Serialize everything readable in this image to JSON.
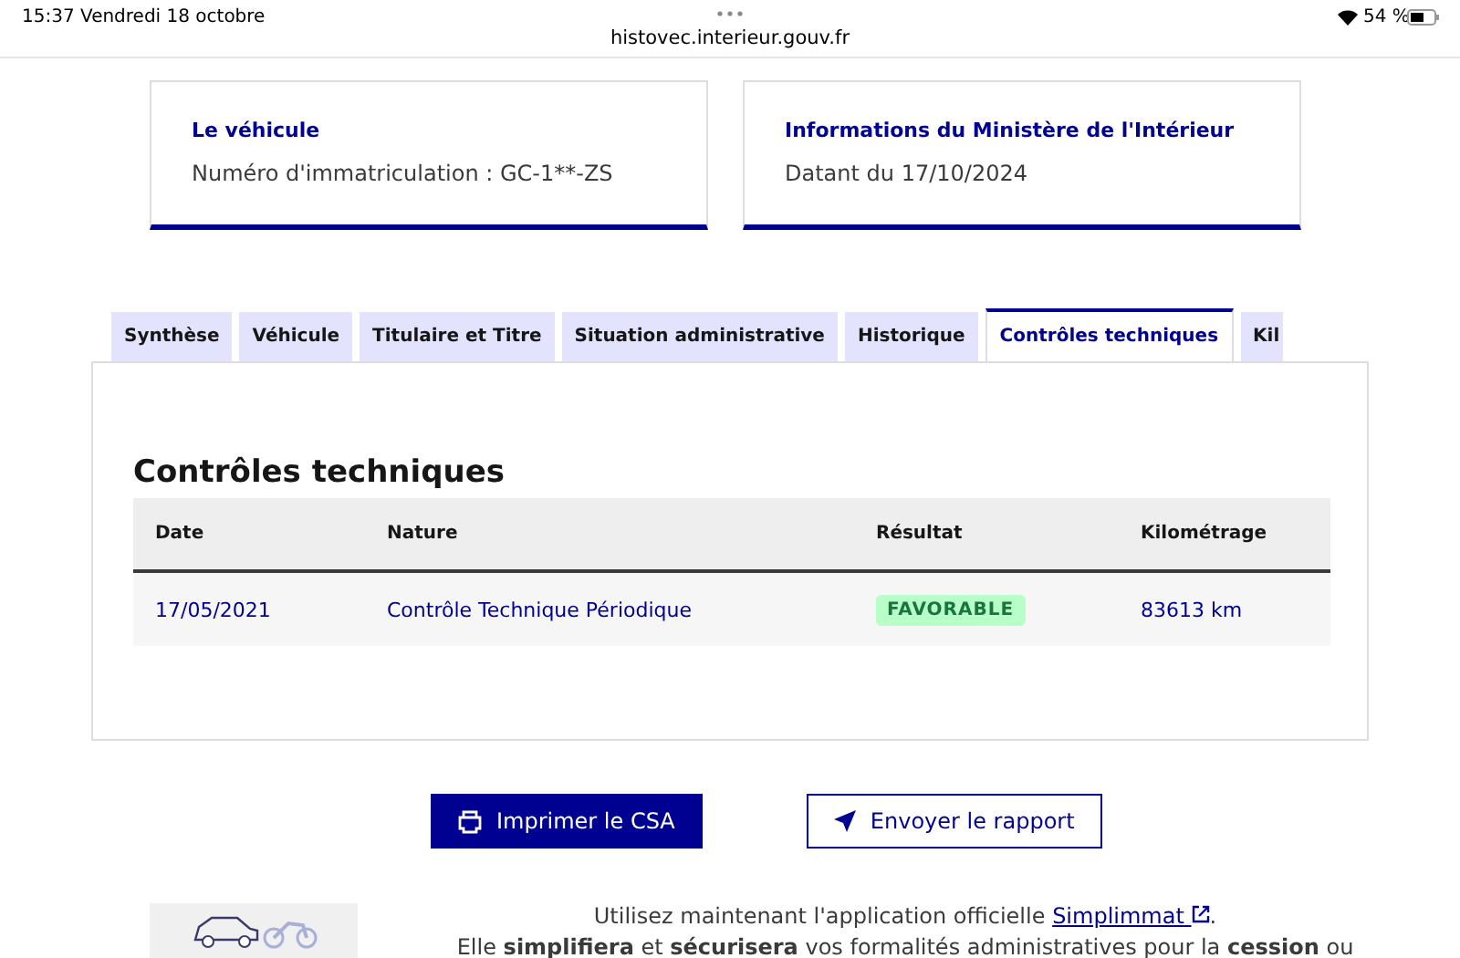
{
  "status_bar": {
    "time": "15:37",
    "date": "Vendredi 18 octobre",
    "url": "histovec.interieur.gouv.fr",
    "battery": "54 %"
  },
  "cards": [
    {
      "title": "Le véhicule",
      "text": "Numéro d'immatriculation : GC-1**-ZS"
    },
    {
      "title": "Informations du Ministère de l'Intérieur",
      "text": "Datant du 17/10/2024"
    }
  ],
  "tabs": [
    {
      "label": "Synthèse",
      "selected": false
    },
    {
      "label": "Véhicule",
      "selected": false
    },
    {
      "label": "Titulaire et Titre",
      "selected": false
    },
    {
      "label": "Situation administrative",
      "selected": false
    },
    {
      "label": "Historique",
      "selected": false
    },
    {
      "label": "Contrôles techniques",
      "selected": true
    },
    {
      "label": "Kil",
      "selected": false
    }
  ],
  "section_title": "Contrôles techniques",
  "table": {
    "columns": [
      "Date",
      "Nature",
      "Résultat",
      "Kilométrage"
    ],
    "rows": [
      {
        "date": "17/05/2021",
        "nature": "Contrôle Technique Périodique",
        "result": "FAVORABLE",
        "mileage": "83613 km"
      }
    ]
  },
  "buttons": [
    {
      "label": "Imprimer le CSA",
      "kind": "primary"
    },
    {
      "label": "Envoyer le rapport",
      "kind": "secondary"
    }
  ],
  "promo": {
    "text": "Utilisez maintenant l'application officielle",
    "link": "Simplimmat",
    "link_end": ".",
    "text2": "Elle **simplifiera** et **sécurisera** vos formalités administratives pour la **cession** ou"
  }
}
